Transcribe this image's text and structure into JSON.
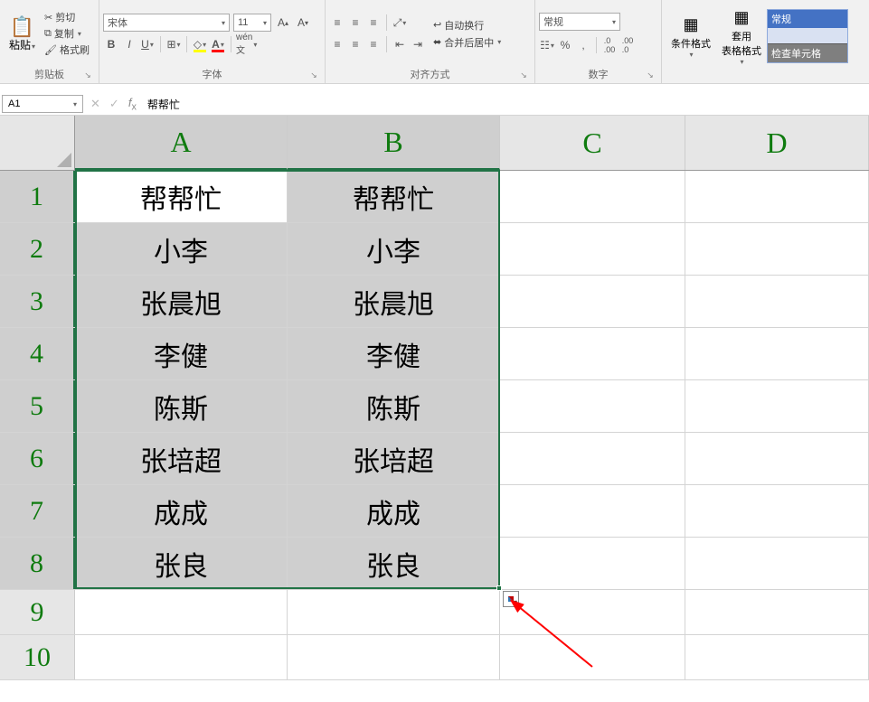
{
  "ribbon": {
    "clipboard": {
      "paste": "粘贴",
      "cut": "剪切",
      "copy": "复制",
      "format_painter": "格式刷",
      "label": "剪贴板"
    },
    "font": {
      "name": "宋体",
      "size": "11",
      "label": "字体"
    },
    "alignment": {
      "wrap": "自动换行",
      "merge": "合并后居中",
      "label": "对齐方式"
    },
    "number": {
      "format": "常规",
      "label": "数字"
    },
    "styles": {
      "cond": "条件格式",
      "table": "套用\n表格格式",
      "normal": "常规",
      "check": "检查单元格"
    }
  },
  "formula_bar": {
    "name_box": "A1",
    "formula": "帮帮忙"
  },
  "columns": [
    "A",
    "B",
    "C",
    "D"
  ],
  "rows": [
    {
      "n": "1",
      "A": "帮帮忙",
      "B": "帮帮忙"
    },
    {
      "n": "2",
      "A": "小李",
      "B": "小李"
    },
    {
      "n": "3",
      "A": "张晨旭",
      "B": "张晨旭"
    },
    {
      "n": "4",
      "A": "李健",
      "B": "李健"
    },
    {
      "n": "5",
      "A": "陈斯",
      "B": "陈斯"
    },
    {
      "n": "6",
      "A": "张培超",
      "B": "张培超"
    },
    {
      "n": "7",
      "A": "成成",
      "B": "成成"
    },
    {
      "n": "8",
      "A": "张良",
      "B": "张良"
    },
    {
      "n": "9",
      "A": "",
      "B": ""
    },
    {
      "n": "10",
      "A": "",
      "B": ""
    }
  ]
}
